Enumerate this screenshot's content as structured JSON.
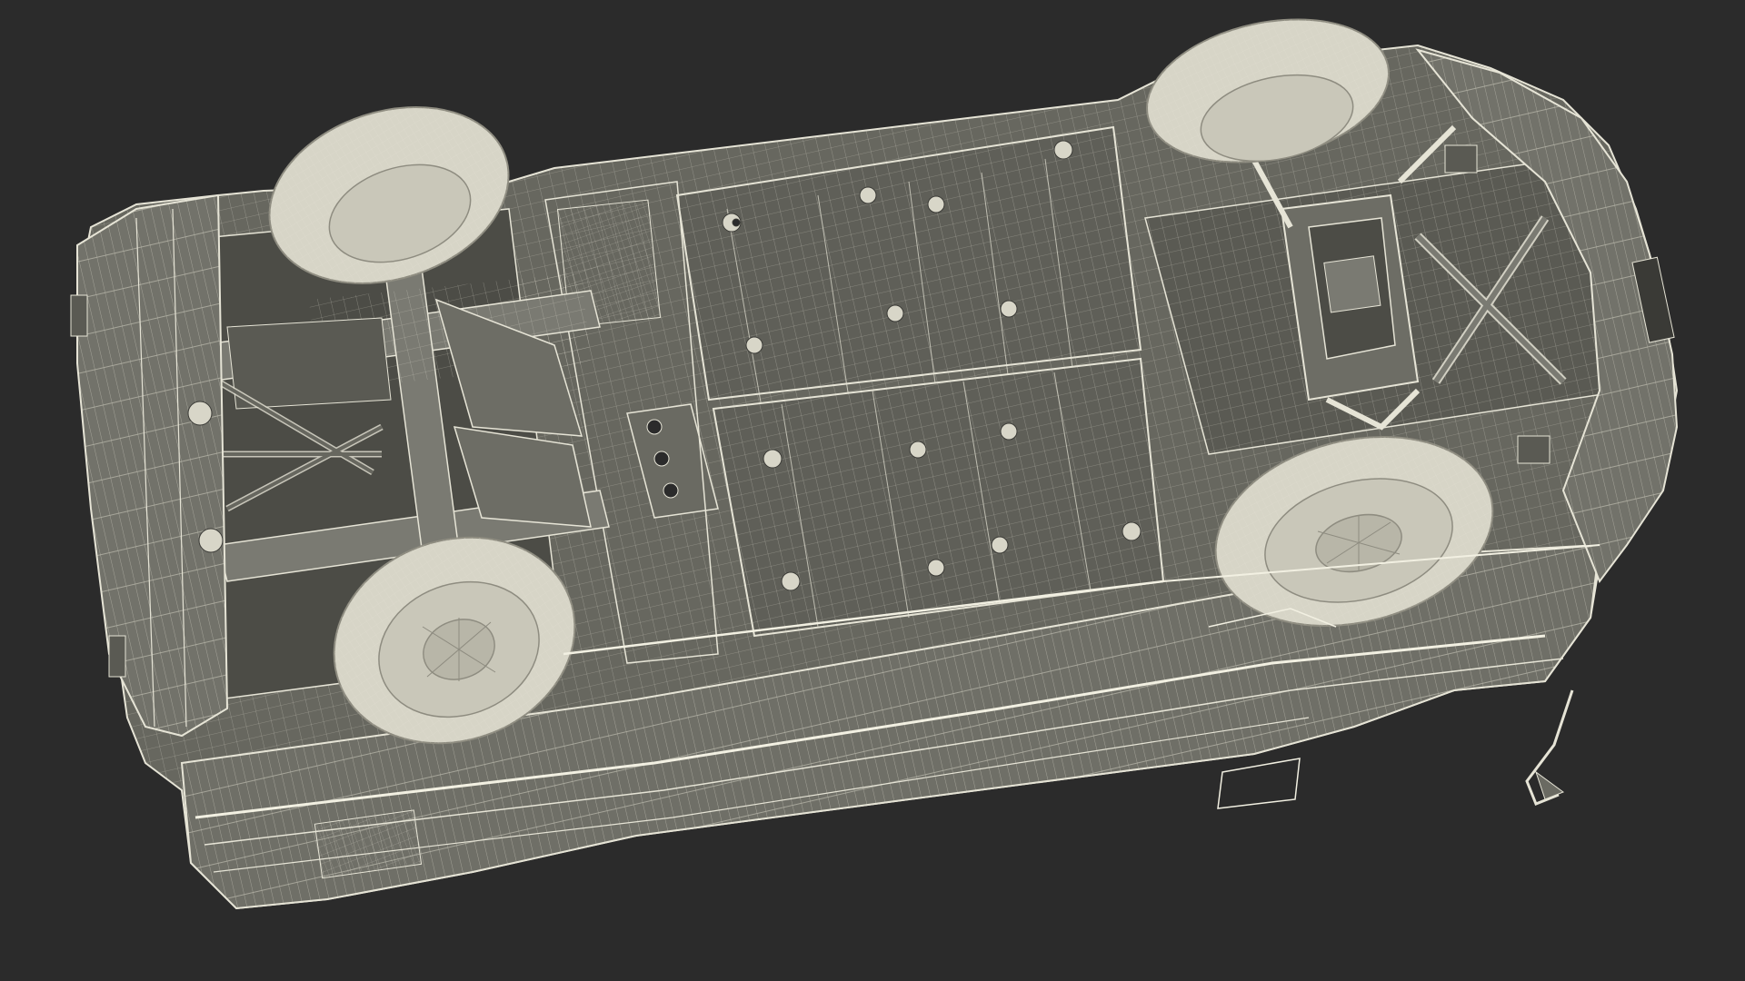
{
  "scene": {
    "background_color": "#2b2b2b",
    "subject": "car-underbody-wireframe",
    "colors": {
      "body_fill": "#67675f",
      "body_fill_dark": "#4c4c46",
      "body_fill_light": "#7a7a72",
      "wire": "#e6e4d6",
      "wire_dim": "#bdbbad",
      "tire_fill": "#d7d5c7",
      "tire_line": "#8e8c80"
    }
  }
}
